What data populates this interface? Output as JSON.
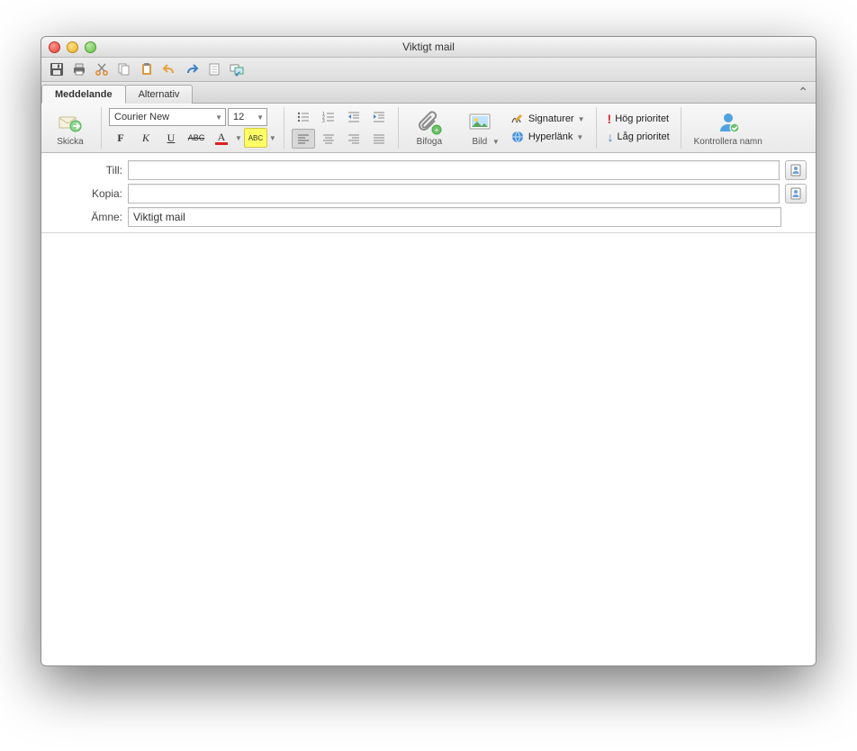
{
  "window": {
    "title": "Viktigt mail"
  },
  "tabs": {
    "meddelande": "Meddelande",
    "alternativ": "Alternativ"
  },
  "ribbon": {
    "send": "Skicka",
    "font_name": "Courier New",
    "font_size": "12",
    "attach": "Bifoga",
    "picture": "Bild",
    "signatures": "Signaturer",
    "hyperlink": "Hyperlänk",
    "high_priority": "Hög prioritet",
    "low_priority": "Låg prioritet",
    "check_names": "Kontrollera namn",
    "highlight_sample": "ABC"
  },
  "headers": {
    "to_label": "Till:",
    "cc_label": "Kopia:",
    "subject_label": "Ämne:",
    "to_value": "",
    "cc_value": "",
    "subject_value": "Viktigt mail"
  }
}
